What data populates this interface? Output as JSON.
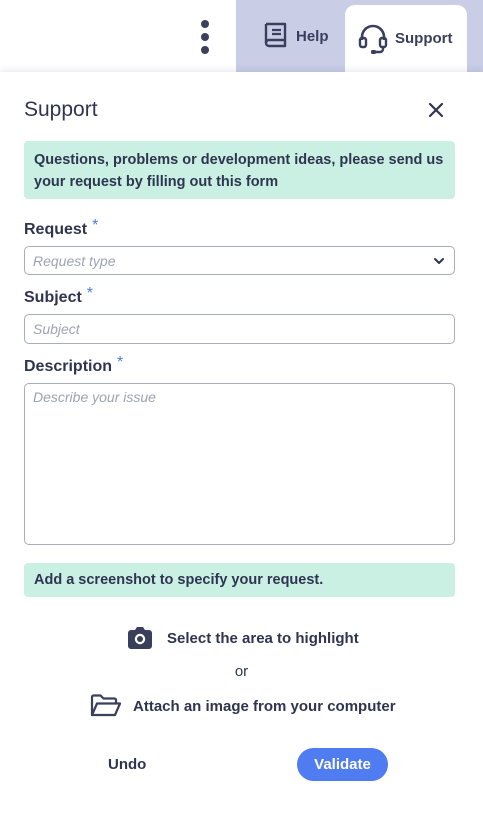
{
  "header": {
    "help_label": "Help",
    "support_label": "Support",
    "tab_bg_color": "#c9cde6"
  },
  "panel": {
    "title": "Support",
    "intro": "Questions, problems or development ideas, please send us your request by filling out this form",
    "request": {
      "label": "Request",
      "required_mark": "*",
      "placeholder": "Request type"
    },
    "subject": {
      "label": "Subject",
      "required_mark": "*",
      "placeholder": "Subject"
    },
    "description": {
      "label": "Description",
      "required_mark": "*",
      "placeholder": "Describe your issue"
    },
    "screenshot_hint": "Add a screenshot to specify your request.",
    "select_area_label": "Select the area to highlight",
    "or_label": "or",
    "attach_label": "Attach an image from your computer",
    "undo_label": "Undo",
    "validate_label": "Validate"
  },
  "colors": {
    "accent": "#4f7cf0",
    "info_bg": "#c9f0e2",
    "text": "#2f3550"
  },
  "icons": {
    "kebab": "more-vertical-icon",
    "help": "book-icon",
    "support": "headset-icon",
    "close": "close-icon",
    "dropdown": "chevron-down-icon",
    "camera": "camera-icon",
    "folder": "folder-open-icon"
  }
}
